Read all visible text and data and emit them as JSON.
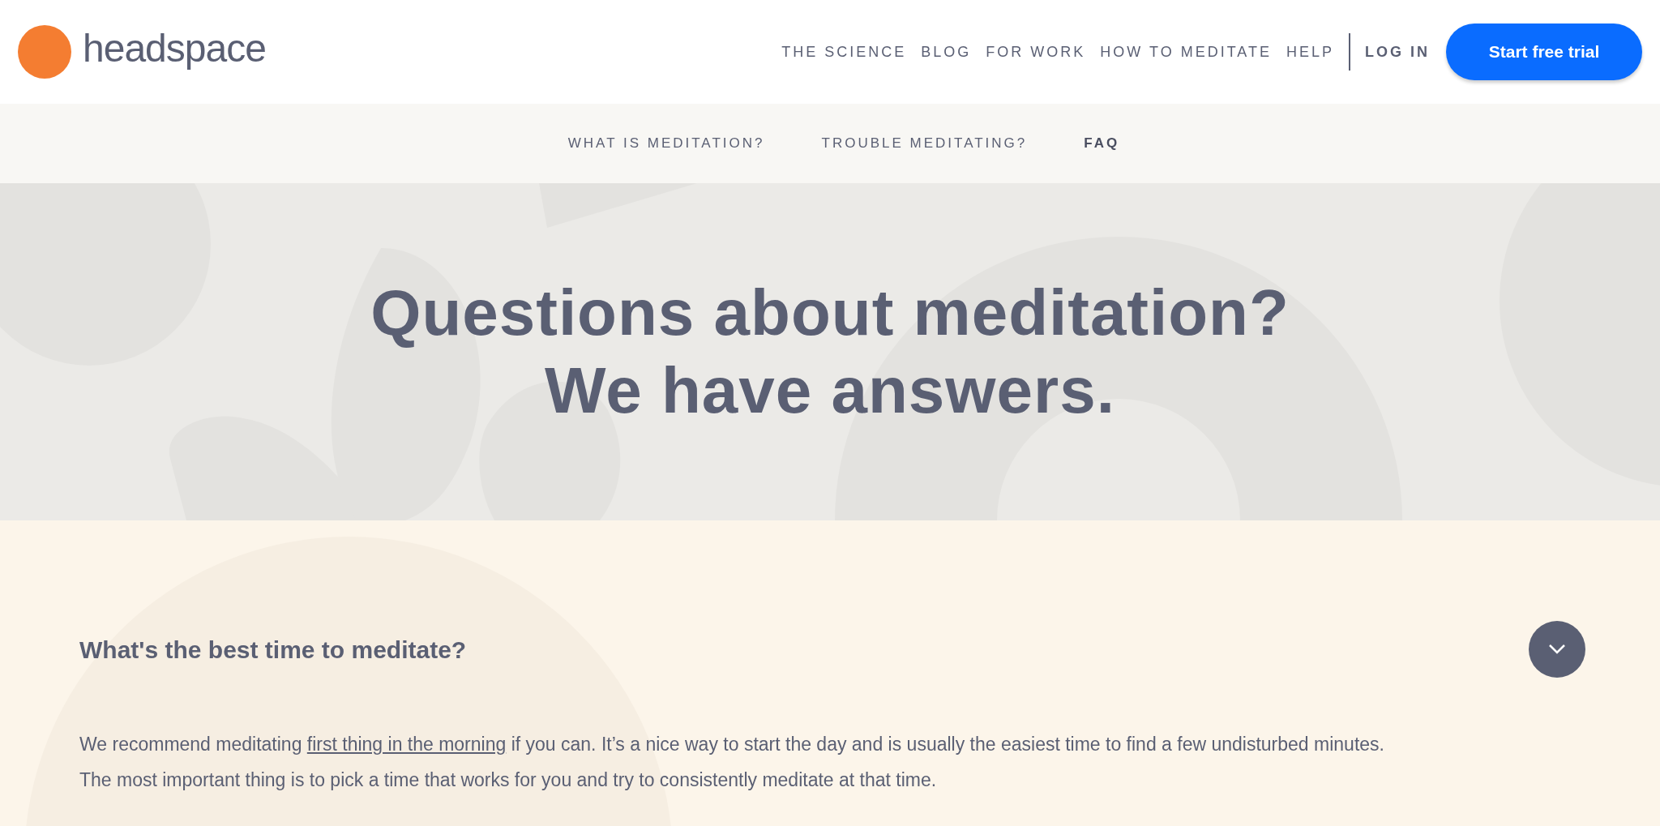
{
  "logo": {
    "text": "headspace"
  },
  "nav": {
    "items": [
      "THE SCIENCE",
      "BLOG",
      "FOR WORK",
      "HOW TO MEDITATE",
      "HELP"
    ],
    "login": "LOG IN",
    "cta": "Start free trial"
  },
  "subnav": [
    {
      "label": "WHAT IS MEDITATION?",
      "selected": false
    },
    {
      "label": "TROUBLE MEDITATING?",
      "selected": false
    },
    {
      "label": "FAQ",
      "selected": true
    }
  ],
  "hero": {
    "lines": [
      "Questions about meditation?",
      "We have answers."
    ]
  },
  "faq": [
    {
      "question": "What's the best time to meditate?",
      "expanded": true,
      "answer": {
        "before": "We recommend meditating ",
        "link": "first thing in the morning",
        "after": " if you can. It’s a nice way to start the day and is usually the easiest time to find a few undisturbed minutes. The most important thing is to pick a time that works for you and try to consistently meditate at that time."
      }
    }
  ]
}
